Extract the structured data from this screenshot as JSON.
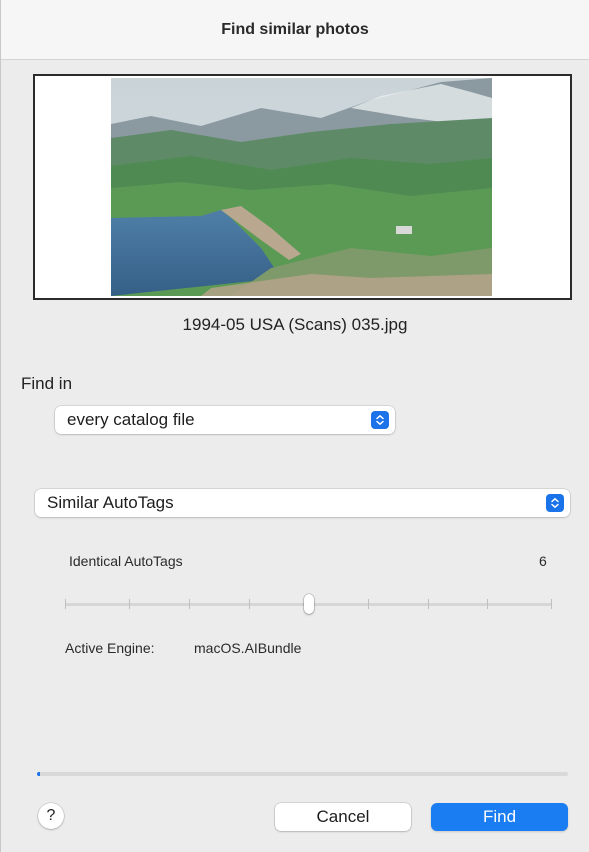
{
  "window": {
    "title": "Find similar photos"
  },
  "preview": {
    "filename": "1994-05 USA (Scans) 035.jpg"
  },
  "find_in": {
    "label": "Find in",
    "selected": "every catalog file"
  },
  "method": {
    "selected": "Similar AutoTags"
  },
  "identical": {
    "label": "Identical AutoTags",
    "value": "6",
    "slider_fraction": 0.5
  },
  "engine": {
    "label": "Active Engine:",
    "value": "macOS.AIBundle"
  },
  "progress": {
    "fraction": 0.005
  },
  "buttons": {
    "help": "?",
    "cancel": "Cancel",
    "find": "Find"
  },
  "colors": {
    "accent": "#1a7ef2"
  },
  "icons": {
    "popup": "chevron-up-down-icon"
  }
}
